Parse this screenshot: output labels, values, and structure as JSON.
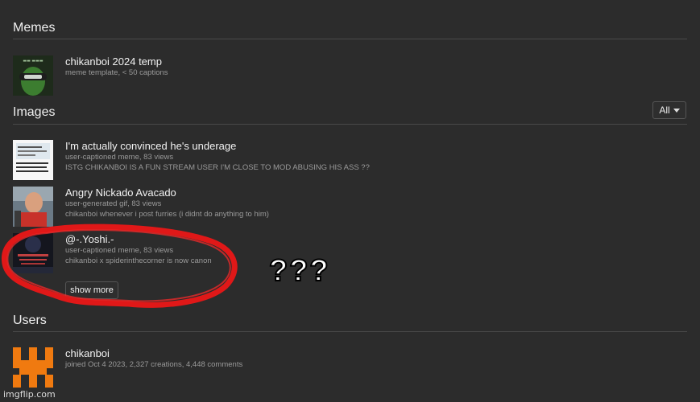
{
  "sections": {
    "memes": "Memes",
    "images": "Images",
    "users": "Users"
  },
  "memes": [
    {
      "title": "chikanboi 2024 temp",
      "sub": "meme template, < 50 captions"
    }
  ],
  "filter": {
    "label": "All"
  },
  "images": [
    {
      "title": "I'm actually convinced he's underage",
      "meta": "user-captioned meme, 83 views",
      "desc": "ISTG CHIKANBOI IS A FUN STREAM USER I'M CLOSE TO MOD ABUSING HIS ASS ??"
    },
    {
      "title": "Angry Nickado Avacado",
      "meta": "user-generated gif, 83 views",
      "desc": "chikanboi whenever i post furries (i didnt do anything to him)"
    },
    {
      "title": "@-.Yoshi.-",
      "meta": "user-captioned meme, 83 views",
      "desc": "chikanboi x spiderinthecorner is now canon"
    }
  ],
  "show_more": "show more",
  "users": [
    {
      "name": "chikanboi",
      "sub": "joined Oct 4 2023, 2,327 creations, 4,448 comments"
    }
  ],
  "overlay_text": "???",
  "watermark": "imgflip.com",
  "colors": {
    "annotation": "#e01818",
    "user_icon": "#f07a10",
    "meme_thumb": "#2f6b2a"
  }
}
